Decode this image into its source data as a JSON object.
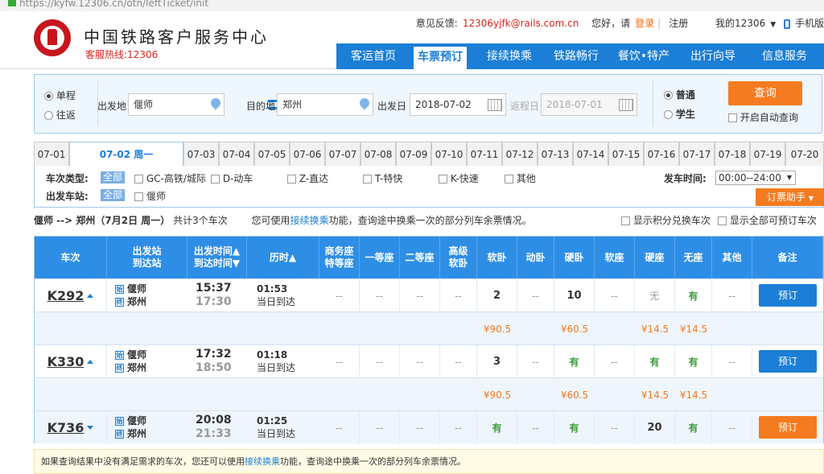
{
  "browser": {
    "url": "https://kyfw.12306.cn/otn/leftTicket/init"
  },
  "header": {
    "brand": "中国铁路客户服务中心",
    "hotline": "客服热线:12306",
    "feedback_label": "意见反馈:",
    "feedback_email": "12306yjfk@rails.com.cn",
    "greeting": "您好，请",
    "login": "登录",
    "register": "注册",
    "my12306": "我的12306",
    "mobile": "手机版"
  },
  "nav": [
    "客运首页",
    "车票预订",
    "接续换乘",
    "铁路畅行",
    "餐饮•特产",
    "出行向导",
    "信息服务"
  ],
  "search": {
    "one_way": "单程",
    "round_trip": "往返",
    "from_label": "出发地",
    "from_value": "偃师",
    "to_label": "目的地",
    "to_value": "郑州",
    "date_label": "出发日",
    "date_value": "2018-07-02",
    "return_label": "返程日",
    "return_value": "2018-07-01",
    "normal": "普通",
    "student": "学生",
    "query": "查询",
    "auto_query": "开启自动查询"
  },
  "dates": [
    "07-01",
    "07-02 周一",
    "07-03",
    "07-04",
    "07-05",
    "07-06",
    "07-07",
    "07-08",
    "07-09",
    "07-10",
    "07-11",
    "07-12",
    "07-13",
    "07-14",
    "07-15",
    "07-16",
    "07-17",
    "07-18",
    "07-19",
    "07-20"
  ],
  "filters": {
    "type_label": "车次类型:",
    "all": "全部",
    "types": [
      "GC-高铁/城际",
      "D-动车",
      "Z-直达",
      "T-特快",
      "K-快速",
      "其他"
    ],
    "station_label": "出发车站:",
    "station": "偃师",
    "time_label": "发车时间:",
    "time_value": "00:00--24:00",
    "helper": "订票助手"
  },
  "summary": {
    "route": "偃师 --> 郑州（7月2日  周一）",
    "count": "共计3个车次",
    "tip_pre": "您可使用",
    "tip_link": "接续换乘",
    "tip_post": "功能，查询途中换乘一次的部分列车余票情况。",
    "opt1": "显示积分兑换车次",
    "opt2": "显示全部可预订车次"
  },
  "table": {
    "headers": [
      "车次",
      "出发站\n到达站",
      "出发时间▲\n到达时间▼",
      "历时▲",
      "商务座\n特等座",
      "一等座",
      "二等座",
      "高级\n软卧",
      "软卧",
      "动卧",
      "硬卧",
      "软座",
      "硬座",
      "无座",
      "其他",
      "备注"
    ],
    "trains": [
      {
        "no": "K292",
        "dir": "up",
        "from": "偃师",
        "to": "郑州",
        "dep": "15:37",
        "arr": "17:30",
        "dur": "01:53",
        "arrive_note": "当日到达",
        "seats": [
          "--",
          "--",
          "--",
          "--",
          "2",
          "--",
          "10",
          "--",
          "无",
          "有",
          "--"
        ],
        "prices": [
          "",
          "",
          "",
          "",
          "¥90.5",
          "",
          "¥60.5",
          "",
          "¥14.5",
          "¥14.5",
          ""
        ],
        "book": "预订",
        "book_color": "blue"
      },
      {
        "no": "K330",
        "dir": "up",
        "from": "偃师",
        "to": "郑州",
        "dep": "17:32",
        "arr": "18:50",
        "dur": "01:18",
        "arrive_note": "当日到达",
        "seats": [
          "--",
          "--",
          "--",
          "--",
          "3",
          "--",
          "有",
          "--",
          "有",
          "有",
          "--"
        ],
        "prices": [
          "",
          "",
          "",
          "",
          "¥90.5",
          "",
          "¥60.5",
          "",
          "¥14.5",
          "¥14.5",
          ""
        ],
        "book": "预订",
        "book_color": "blue"
      },
      {
        "no": "K736",
        "dir": "down",
        "from": "偃师",
        "to": "郑州",
        "dep": "20:08",
        "arr": "21:33",
        "dur": "01:25",
        "arrive_note": "当日到达",
        "seats": [
          "--",
          "--",
          "--",
          "--",
          "有",
          "--",
          "有",
          "--",
          "20",
          "有",
          "--"
        ],
        "prices": [],
        "book": "预订",
        "book_color": "orange"
      }
    ]
  },
  "notice": {
    "pre": "如果查询结果中没有满足需求的车次，您还可以使用",
    "link": "接续换乘",
    "post": "功能，查询途中换乘一次的部分列车余票情况。"
  },
  "colors": {
    "primary": "#1b7ed7",
    "accent": "#f47b20",
    "brand_red": "#c8161d",
    "available": "#3a9b3a"
  }
}
